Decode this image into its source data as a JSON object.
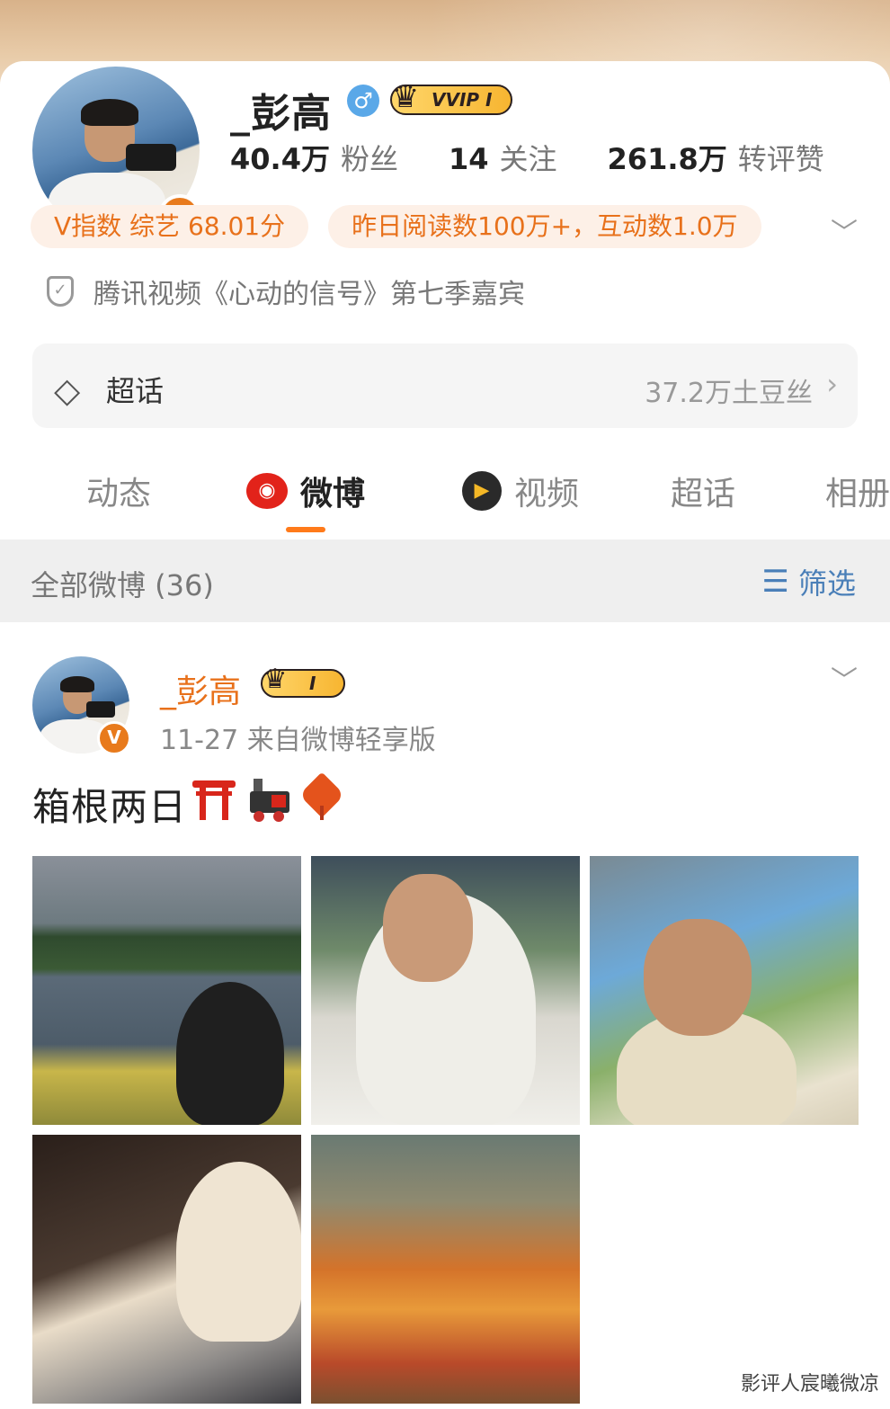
{
  "profile": {
    "name": "_彭高",
    "gender_symbol": "♂",
    "vip_badge": "VVIP I",
    "verified_mark": "V",
    "stats": [
      {
        "value": "40.4万",
        "label": "粉丝"
      },
      {
        "value": "14",
        "label": "关注"
      },
      {
        "value": "261.8万",
        "label": "转评赞"
      }
    ],
    "chips": [
      "V指数 综艺 68.01分",
      "昨日阅读数100万+，互动数1.0万"
    ],
    "verification": "腾讯视频《心动的信号》第七季嘉宾",
    "super_topic": {
      "label": "超话",
      "count": "37.2万土豆丝"
    }
  },
  "tabs": [
    {
      "label": "动态",
      "icon": ""
    },
    {
      "label": "微博",
      "icon": "weibo-icon"
    },
    {
      "label": "视频",
      "icon": "video-icon"
    },
    {
      "label": "超话",
      "icon": ""
    },
    {
      "label": "相册",
      "icon": ""
    }
  ],
  "filter_bar": {
    "all_label": "全部微博 (36)",
    "filter_label": "筛选"
  },
  "post": {
    "author": "_彭高",
    "vip_badge": "I",
    "time_source": "11-27  来自微博轻享版",
    "text": "箱根两日",
    "emojis": [
      "torii-icon",
      "train-icon",
      "maple-leaf-icon"
    ],
    "photo_count": 5
  },
  "watermark": "影评人宸曦微凉",
  "colors": {
    "accent": "#ff7a1a",
    "name": "#e8711b",
    "link": "#4a7fb8",
    "weibo_red": "#e2231a"
  }
}
